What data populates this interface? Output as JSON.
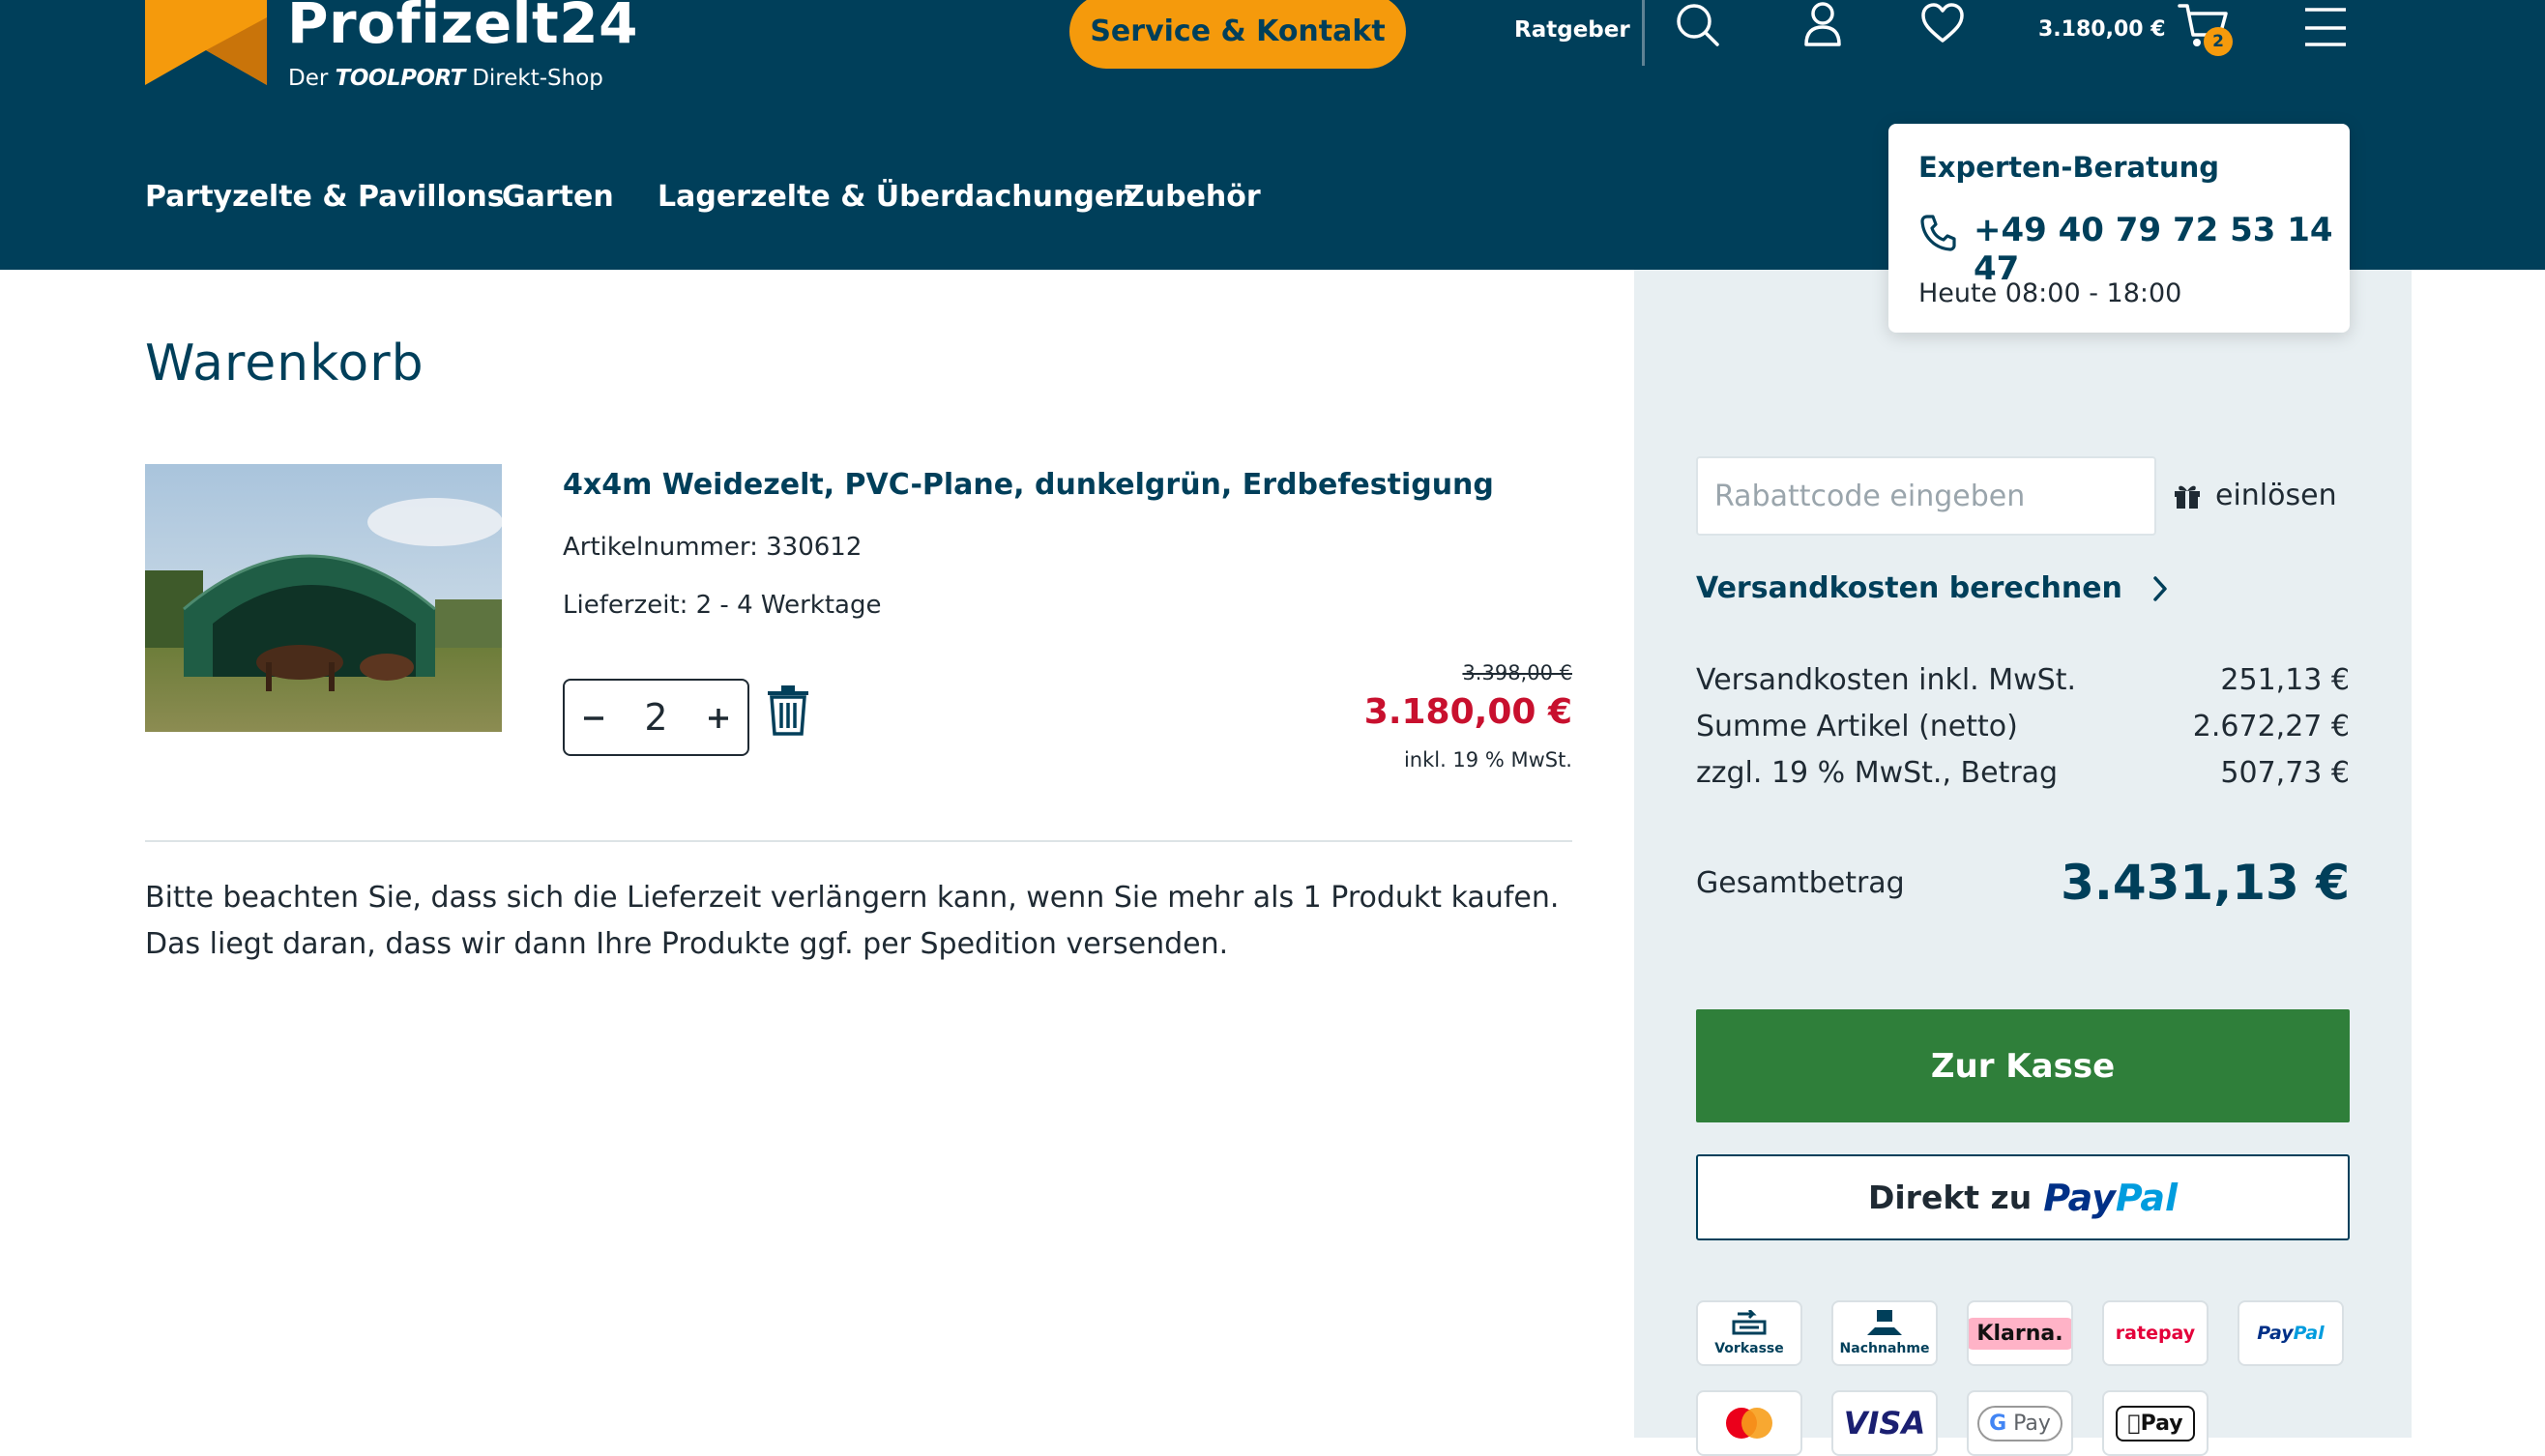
{
  "brand": {
    "name": "Profizelt24",
    "tagline_prefix": "Der",
    "tagline_brand": "TOOLPORT",
    "tagline_suffix": "Direkt-Shop",
    "colors": {
      "primary": "#003f5a",
      "accent": "#f59a0c",
      "price_red": "#c8102e",
      "checkout_green": "#2f7f3a"
    }
  },
  "header": {
    "service_button": "Service & Kontakt",
    "ratgeber_link": "Ratgeber",
    "icons": [
      "search-icon",
      "user-icon",
      "heart-icon",
      "cart-icon",
      "menu-icon"
    ],
    "cart_total": "3.180,00 €",
    "cart_count": "2"
  },
  "nav": {
    "items": [
      {
        "label": "Partyzelte & Pavillons"
      },
      {
        "label": "Garten"
      },
      {
        "label": "Lagerzelte & Überdachungen"
      },
      {
        "label": "Zubehör"
      }
    ]
  },
  "expert": {
    "title": "Experten-Beratung",
    "phone": "+49 40 79 72 53 14 47",
    "hours": "Heute 08:00 - 18:00"
  },
  "cart": {
    "title": "Warenkorb",
    "item": {
      "name": "4x4m Weidezelt, PVC-Plane, dunkelgrün, Erdbefestigung",
      "article_number": "Artikelnummer: 330612",
      "delivery_time": "Lieferzeit: 2 - 4 Werktage",
      "quantity": "2",
      "old_price": "3.398,00 €",
      "price": "3.180,00 €",
      "vat_note": "inkl. 19 % MwSt."
    },
    "notice": "Bitte beachten Sie, dass sich die Lieferzeit verlängern kann, wenn Sie mehr als 1 Produkt kaufen. Das liegt daran, dass wir dann Ihre Produkte ggf. per Spedition versenden."
  },
  "summary": {
    "coupon_placeholder": "Rabattcode eingeben",
    "coupon_button": "einlösen",
    "shipping_calc": "Versandkosten berechnen",
    "rows": [
      {
        "label": "Versandkosten inkl. MwSt.",
        "value": "251,13 €"
      },
      {
        "label": "Summe Artikel (netto)",
        "value": "2.672,27 €"
      },
      {
        "label": "zzgl. 19 % MwSt., Betrag",
        "value": "507,73 €"
      }
    ],
    "total_label": "Gesamtbetrag",
    "total_value": "3.431,13 €",
    "checkout_button": "Zur Kasse",
    "paypal_prefix": "Direkt zu",
    "paypal_a": "Pay",
    "paypal_b": "Pal"
  },
  "payment_methods": {
    "vorkasse": "Vorkasse",
    "nachnahme": "Nachnahme",
    "klarna": "Klarna.",
    "ratepay": "ratepay",
    "paypal_a": "Pay",
    "paypal_b": "Pal",
    "visa": "VISA",
    "gpay_g": "G",
    "gpay_pay": "Pay",
    "applepay": "Pay"
  }
}
